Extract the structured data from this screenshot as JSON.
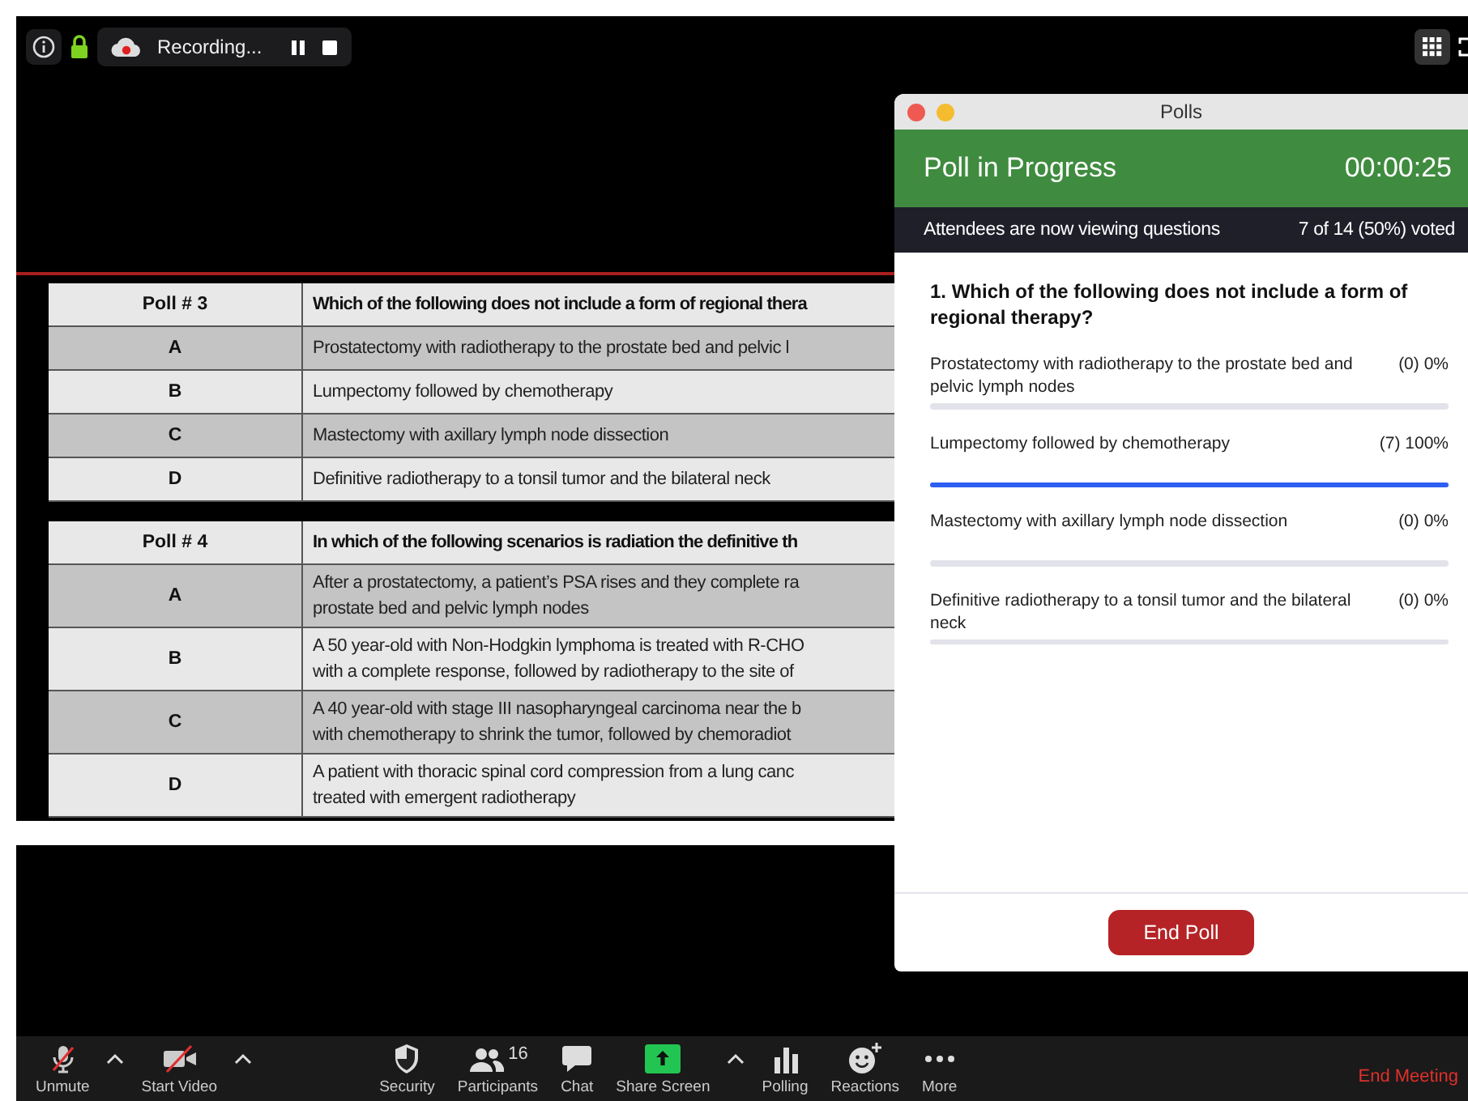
{
  "meeting_bar": {
    "recording_label": "Recording..."
  },
  "slide": {
    "tables": [
      {
        "header": [
          "Poll # 3",
          "Which of the following does not include a form of regional thera"
        ],
        "rows": [
          {
            "letter": "A",
            "lines": [
              "Prostatectomy with radiotherapy to the prostate bed and pelvic l"
            ]
          },
          {
            "letter": "B",
            "lines": [
              "Lumpectomy followed by chemotherapy"
            ]
          },
          {
            "letter": "C",
            "lines": [
              "Mastectomy with axillary lymph node dissection"
            ]
          },
          {
            "letter": "D",
            "lines": [
              "Definitive radiotherapy to a tonsil tumor and the bilateral neck"
            ]
          }
        ]
      },
      {
        "header": [
          "Poll # 4",
          "In which of the following scenarios is radiation the definitive th"
        ],
        "rows": [
          {
            "letter": "A",
            "lines": [
              "After a prostatectomy, a patient’s PSA rises and they complete ra",
              "prostate bed and pelvic lymph nodes"
            ]
          },
          {
            "letter": "B",
            "lines": [
              "A 50 year-old with Non-Hodgkin lymphoma is treated with R-CHO",
              "with a complete response, followed by radiotherapy to the site of"
            ]
          },
          {
            "letter": "C",
            "lines": [
              "A 40 year-old with stage III nasopharyngeal carcinoma near the b",
              "with chemotherapy to shrink the tumor, followed by chemoradiot"
            ]
          },
          {
            "letter": "D",
            "lines": [
              "A patient with thoracic spinal cord compression from a lung canc",
              "treated with emergent radiotherapy"
            ]
          }
        ]
      }
    ]
  },
  "polls_window": {
    "title": "Polls",
    "status": "Poll in Progress",
    "timer": "00:00:25",
    "info": "Attendees are now viewing questions",
    "voted": "7 of 14 (50%) voted",
    "question": "1. Which of the following does not include a form of regional therapy?",
    "answers": [
      {
        "text": "Prostatectomy with radiotherapy to the prostate bed and pelvic lymph nodes",
        "result": "(0) 0%",
        "level": 0
      },
      {
        "text": "Lumpectomy followed by chemotherapy",
        "result": "(7) 100%",
        "level": 1
      },
      {
        "text": "Mastectomy with axillary lymph node dissection",
        "result": "(0) 0%",
        "level": 0
      },
      {
        "text": "Definitive radiotherapy to a tonsil tumor and the bilateral neck",
        "result": "(0) 0%",
        "level": 0
      }
    ],
    "end_button": "End Poll"
  },
  "toolbar": {
    "items": [
      {
        "kind": "mic",
        "label": "Unmute",
        "muted": true,
        "menu": true
      },
      {
        "kind": "video",
        "label": "Start Video",
        "muted": true,
        "menu": true
      },
      {
        "kind": "security",
        "label": "Security",
        "menu": false
      },
      {
        "kind": "participants",
        "label": "Participants",
        "count": "16",
        "menu": false
      },
      {
        "kind": "chat",
        "label": "Chat",
        "menu": false
      },
      {
        "kind": "share",
        "label": "Share Screen",
        "menu": true
      },
      {
        "kind": "polling",
        "label": "Polling",
        "menu": false
      },
      {
        "kind": "reactions",
        "label": "Reactions",
        "menu": false
      },
      {
        "kind": "more",
        "label": "More",
        "menu": false
      }
    ],
    "end_meeting": "End Meeting"
  }
}
